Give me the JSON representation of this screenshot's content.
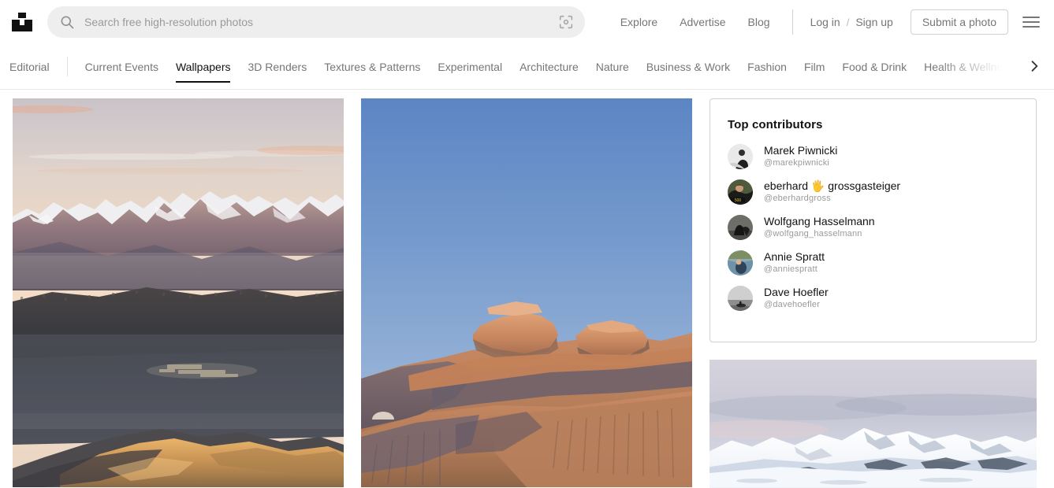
{
  "brand": {
    "logo_icon": "unsplash-logo-icon",
    "accent": "#111111"
  },
  "search": {
    "placeholder": "Search free high-resolution photos",
    "value": "",
    "search_icon": "search-icon",
    "visual_search_icon": "visual-search-icon"
  },
  "header": {
    "links": [
      {
        "label": "Explore"
      },
      {
        "label": "Advertise"
      },
      {
        "label": "Blog"
      }
    ],
    "login_label": "Log in",
    "separator": "/",
    "signup_label": "Sign up",
    "submit_label": "Submit a photo",
    "menu_icon": "hamburger-menu-icon"
  },
  "categories": {
    "editorial": "Editorial",
    "items": [
      {
        "label": "Current Events",
        "active": false
      },
      {
        "label": "Wallpapers",
        "active": true
      },
      {
        "label": "3D Renders",
        "active": false
      },
      {
        "label": "Textures & Patterns",
        "active": false
      },
      {
        "label": "Experimental",
        "active": false
      },
      {
        "label": "Architecture",
        "active": false
      },
      {
        "label": "Nature",
        "active": false
      },
      {
        "label": "Business & Work",
        "active": false
      },
      {
        "label": "Fashion",
        "active": false
      },
      {
        "label": "Film",
        "active": false
      },
      {
        "label": "Food & Drink",
        "active": false
      },
      {
        "label": "Health & Wellness",
        "active": false
      }
    ],
    "next_icon": "chevron-right-icon"
  },
  "photos": [
    {
      "name": "photo-mountain-sunset",
      "alt": "Snow-capped mountain range at sunset with warm hazy sky"
    },
    {
      "name": "photo-desert-hoodoo",
      "alt": "Red sandstone hoodoo rock formations under clear blue sky"
    },
    {
      "name": "photo-snowy-peaks",
      "alt": "Snow covered mountain peaks under pale overcast sky"
    }
  ],
  "contributors": {
    "title": "Top contributors",
    "items": [
      {
        "name": "Marek Piwnicki",
        "handle": "@marekpiwnicki"
      },
      {
        "name": "eberhard 🖐 grossgasteiger",
        "handle": "@eberhardgross"
      },
      {
        "name": "Wolfgang Hasselmann",
        "handle": "@wolfgang_hasselmann"
      },
      {
        "name": "Annie Spratt",
        "handle": "@anniespratt"
      },
      {
        "name": "Dave Hoefler",
        "handle": "@davehoefler"
      }
    ]
  }
}
